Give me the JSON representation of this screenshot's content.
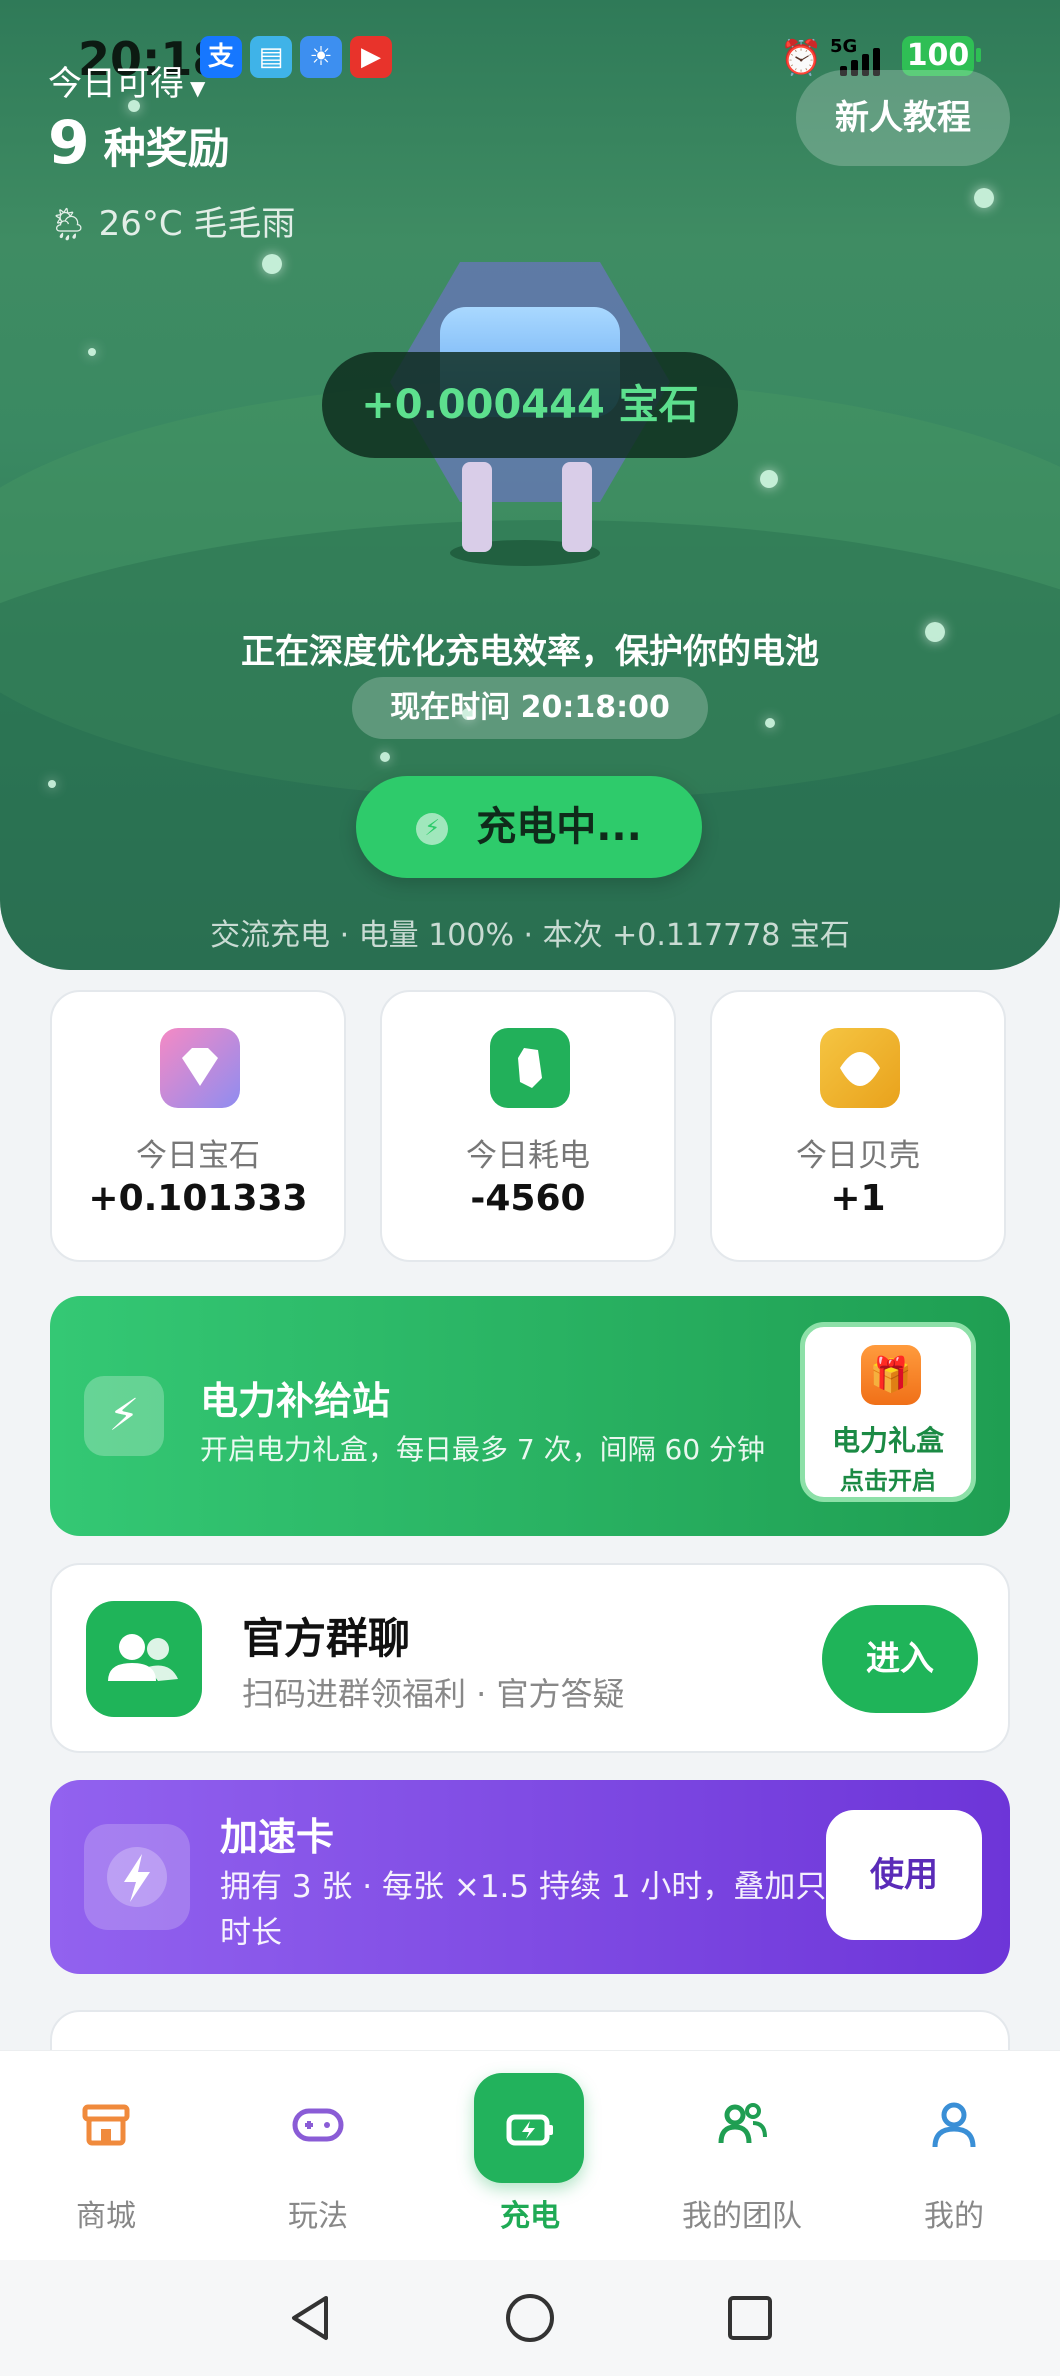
{
  "status_bar": {
    "time": "20:18",
    "network": "5G",
    "battery": "100"
  },
  "header": {
    "today_label": "今日可得",
    "reward_count": "9",
    "reward_text": "种奖励",
    "weather": "26°C 毛毛雨",
    "tutorial_button": "新人教程"
  },
  "hero": {
    "gem_gain": "+0.000444 宝石",
    "optimize_text": "正在深度优化充电效率，保护你的电池",
    "now_time": "现在时间 20:18:00",
    "charging_button": "充电中...",
    "charge_info": "交流充电 · 电量 100% · 本次 +0.117778 宝石"
  },
  "stats": [
    {
      "label": "今日宝石",
      "value": "+0.101333",
      "icon": "diamond-icon",
      "color": "#c47be0"
    },
    {
      "label": "今日耗电",
      "value": "-4560",
      "icon": "crystal-icon",
      "color": "#22b05a"
    },
    {
      "label": "今日贝壳",
      "value": "+1",
      "icon": "shell-icon",
      "color": "#f0b43a"
    }
  ],
  "power_station": {
    "title": "电力补给站",
    "subtitle": "开启电力礼盒，每日最多 7 次，间隔 60 分钟",
    "gift_title": "电力礼盒",
    "gift_action": "点击开启"
  },
  "group_chat": {
    "title": "官方群聊",
    "subtitle": "扫码进群领福利 · 官方答疑",
    "button": "进入"
  },
  "speed_card": {
    "title": "加速卡",
    "subtitle": "拥有 3 张 · 每张 ×1.5 持续 1 小时，叠加只加时长",
    "button": "使用"
  },
  "tabs": [
    {
      "label": "商城",
      "icon": "store-icon",
      "color": "#f08a3c"
    },
    {
      "label": "玩法",
      "icon": "gamepad-icon",
      "color": "#8a5cd6"
    },
    {
      "label": "充电",
      "icon": "battery-charge-icon",
      "color": "#22b25c"
    },
    {
      "label": "我的团队",
      "icon": "team-icon",
      "color": "#1f9e52"
    },
    {
      "label": "我的",
      "icon": "user-icon",
      "color": "#3a8fd6"
    }
  ]
}
